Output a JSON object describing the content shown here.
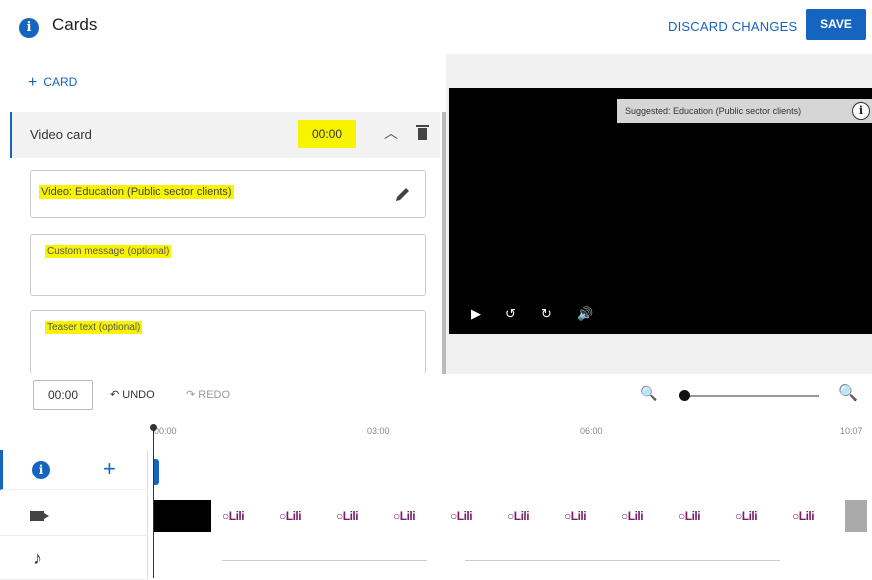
{
  "header": {
    "title": "Cards",
    "discard_label": "DISCARD CHANGES",
    "save_label": "SAVE"
  },
  "editor": {
    "add_card_label": "CARD",
    "card": {
      "type_label": "Video card",
      "time": "00:00",
      "video_field": "Video: Education (Public sector clients)",
      "custom_message_placeholder": "Custom message (optional)",
      "teaser_text_placeholder": "Teaser text (optional)"
    }
  },
  "player": {
    "overlay_text": "Suggested: Education (Public sector clients)"
  },
  "toolbar": {
    "timecode": "00:00",
    "undo_label": "UNDO",
    "redo_label": "REDO"
  },
  "ruler": {
    "ticks": [
      "00:00",
      "03:00",
      "06:00",
      "10:07"
    ]
  },
  "timeline": {
    "thumbnail_text": "○Lili"
  },
  "colors": {
    "accent": "#1565c0",
    "highlight": "#f8f400"
  }
}
